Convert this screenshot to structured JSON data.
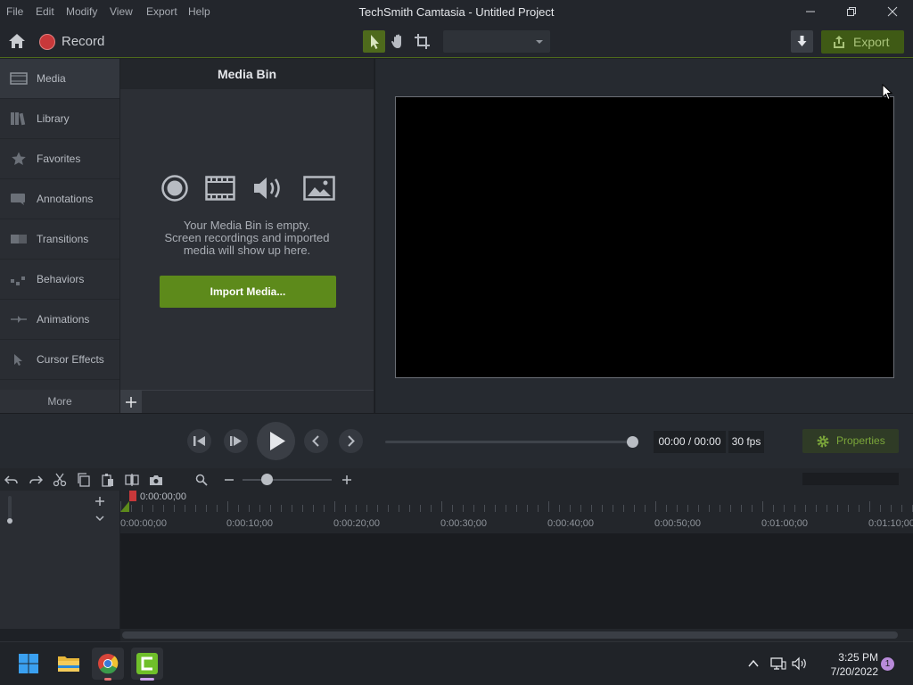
{
  "app": {
    "title": "TechSmith Camtasia - Untitled Project",
    "menu": [
      "File",
      "Edit",
      "Modify",
      "View",
      "Export",
      "Help"
    ]
  },
  "toolbar": {
    "record_label": "Record",
    "export_label": "Export",
    "zoom_value": ""
  },
  "sidebar": {
    "items": [
      {
        "label": "Media",
        "icon": "film-strip-icon"
      },
      {
        "label": "Library",
        "icon": "books-icon"
      },
      {
        "label": "Favorites",
        "icon": "star-icon"
      },
      {
        "label": "Annotations",
        "icon": "annotation-icon"
      },
      {
        "label": "Transitions",
        "icon": "transition-icon"
      },
      {
        "label": "Behaviors",
        "icon": "behavior-icon"
      },
      {
        "label": "Animations",
        "icon": "animation-icon"
      },
      {
        "label": "Cursor Effects",
        "icon": "cursor-icon"
      }
    ],
    "more_label": "More"
  },
  "media_bin": {
    "title": "Media Bin",
    "empty_line1": "Your Media Bin is empty.",
    "empty_line2": "Screen recordings and imported",
    "empty_line3": "media will show up here.",
    "import_label": "Import Media..."
  },
  "playback": {
    "time": "00:00 / 00:00",
    "fps": "30 fps",
    "properties_label": "Properties",
    "position_fraction": 1.0
  },
  "timeline": {
    "playhead_time": "0:00:00;00",
    "ticks": [
      "0:00:00;00",
      "0:00:10;00",
      "0:00:20;00",
      "0:00:30;00",
      "0:00:40;00",
      "0:00:50;00",
      "0:01:00;00",
      "0:01:10;00"
    ]
  },
  "taskbar": {
    "time": "3:25 PM",
    "date": "7/20/2022",
    "notifications": "1"
  },
  "colors": {
    "accent_green": "#5d8a1b",
    "record_red": "#c8383a"
  }
}
